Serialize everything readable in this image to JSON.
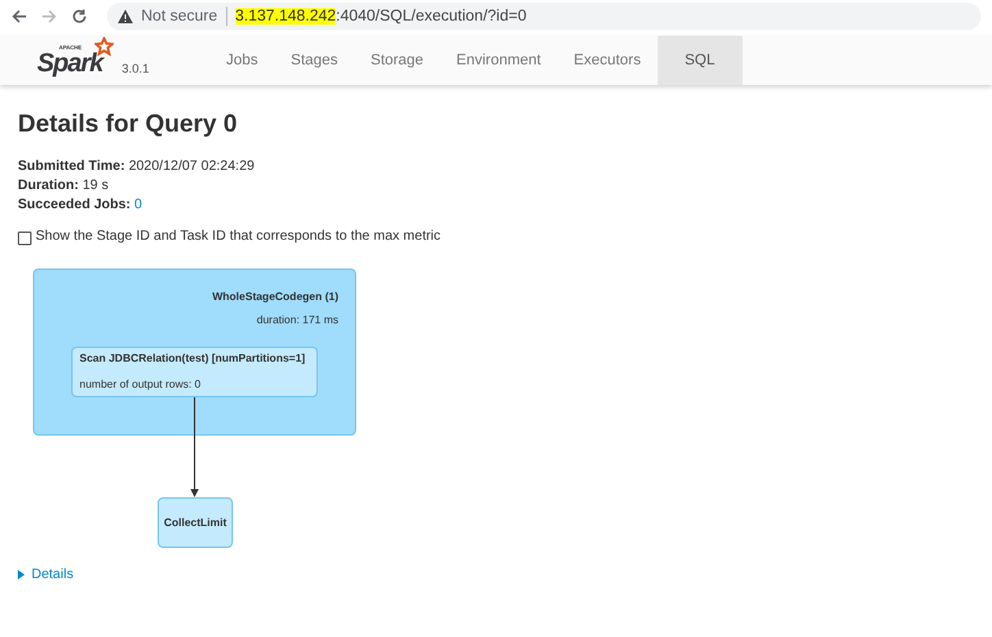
{
  "browser": {
    "security": "Not secure",
    "url_host": "3.137.148.242",
    "url_rest": ":4040/SQL/execution/?id=0"
  },
  "navbar": {
    "logo_top": "APACHE",
    "logo": "Spark",
    "version": "3.0.1",
    "tabs": [
      {
        "label": "Jobs",
        "selected": false
      },
      {
        "label": "Stages",
        "selected": false
      },
      {
        "label": "Storage",
        "selected": false
      },
      {
        "label": "Environment",
        "selected": false
      },
      {
        "label": "Executors",
        "selected": false
      },
      {
        "label": "SQL",
        "selected": true
      }
    ]
  },
  "title": "Details for Query 0",
  "summary": [
    {
      "label": "Submitted Time:",
      "value": "2020/12/07 02:24:29",
      "kind": "text"
    },
    {
      "label": "Duration:",
      "value": "19 s",
      "kind": "text"
    },
    {
      "label": "Succeeded Jobs:",
      "value": "0",
      "kind": "link"
    }
  ],
  "checkbox": {
    "label": "Show the Stage ID and Task ID that corresponds to the max metric",
    "checked": false
  },
  "plan": {
    "cluster": {
      "title": "WholeStageCodegen (1)",
      "metric": "duration: 171 ms"
    },
    "scan": {
      "title": "Scan JDBCRelation(test) [numPartitions=1]",
      "metric": "number of output rows: 0"
    },
    "limit": {
      "title": "CollectLimit"
    }
  },
  "details": {
    "label": "Details",
    "expanded": false
  }
}
